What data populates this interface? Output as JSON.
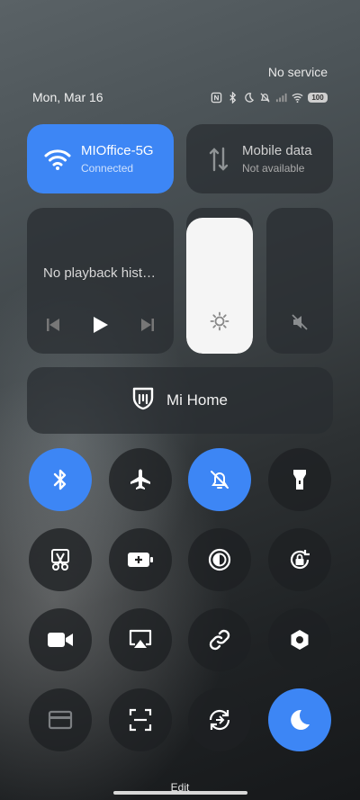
{
  "status": {
    "carrier": "No service",
    "date": "Mon, Mar 16",
    "battery": "100",
    "icons": [
      "nfc-icon",
      "bluetooth-icon",
      "moon-icon",
      "bell-off-icon",
      "signal-icon",
      "wifi-icon",
      "battery-icon"
    ]
  },
  "wifi": {
    "name": "MIOffice-5G",
    "state": "Connected",
    "active": true
  },
  "mobile": {
    "title": "Mobile data",
    "state": "Not available",
    "active": false
  },
  "media": {
    "title": "No playback hist…"
  },
  "brightness": {
    "level": 0.93
  },
  "mihome": {
    "label": "Mi Home"
  },
  "toggles": [
    {
      "icon": "bluetooth-icon",
      "active": true
    },
    {
      "icon": "airplane-icon",
      "active": false
    },
    {
      "icon": "bell-off-icon",
      "active": true
    },
    {
      "icon": "flashlight-icon",
      "active": false
    },
    {
      "icon": "screenshot-cut-icon",
      "active": false
    },
    {
      "icon": "battery-saver-icon",
      "active": false
    },
    {
      "icon": "contrast-icon",
      "active": false
    },
    {
      "icon": "rotation-lock-icon",
      "active": false
    },
    {
      "icon": "video-camera-icon",
      "active": false
    },
    {
      "icon": "cast-icon",
      "active": false
    },
    {
      "icon": "link-icon",
      "active": false
    },
    {
      "icon": "settings-hex-icon",
      "active": false
    },
    {
      "icon": "card-icon",
      "active": false
    },
    {
      "icon": "scan-icon",
      "active": false
    },
    {
      "icon": "sync-icon",
      "active": false
    },
    {
      "icon": "moon-icon",
      "active": true
    }
  ],
  "edit_label": "Edit",
  "colors": {
    "accent": "#3d86f5"
  }
}
